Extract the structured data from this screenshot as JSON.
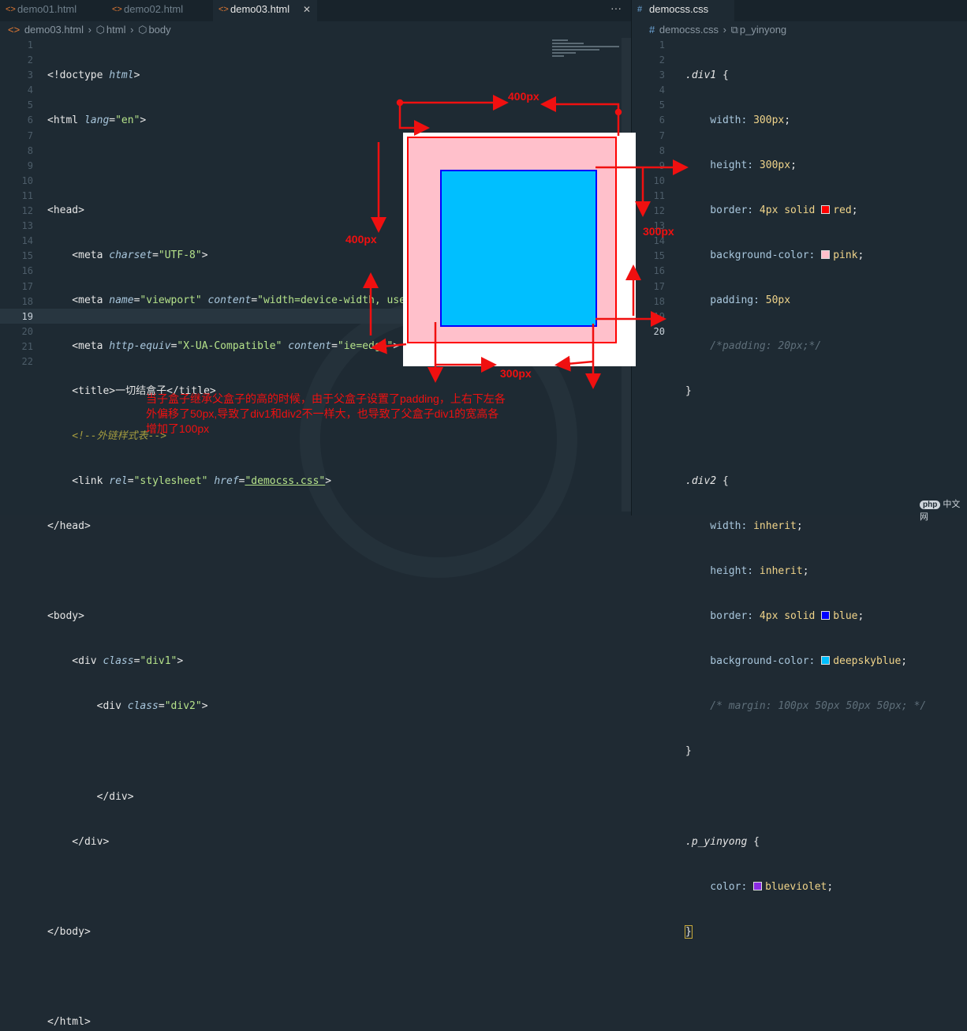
{
  "left_tabs": [
    {
      "label": "demo01.html",
      "active": false
    },
    {
      "label": "demo02.html",
      "active": false
    },
    {
      "label": "demo03.html",
      "active": true
    }
  ],
  "more_glyph": "···",
  "close_glyph": "✕",
  "left_crumb": [
    "demo03.html",
    "html",
    "body"
  ],
  "right_tab": "democss.css",
  "right_crumb": [
    "democss.css",
    "p_yinyong"
  ],
  "left_line_numbers": [
    "1",
    "2",
    "3",
    "4",
    "5",
    "6",
    "7",
    "8",
    "9",
    "10",
    "11",
    "12",
    "13",
    "14",
    "15",
    "16",
    "17",
    "18",
    "19",
    "20",
    "21",
    "22"
  ],
  "right_line_numbers": [
    "1",
    "2",
    "3",
    "4",
    "5",
    "6",
    "7",
    "8",
    "9",
    "10",
    "11",
    "12",
    "13",
    "14",
    "15",
    "16",
    "17",
    "18",
    "19",
    "20"
  ],
  "html_code": {
    "l1": {
      "a": "<!doctype ",
      "b": "html",
      "c": ">"
    },
    "l2": {
      "a": "<html ",
      "b": "lang",
      "c": "=",
      "d": "\"en\"",
      "e": ">"
    },
    "l4": "<head>",
    "l5": {
      "a": "    <meta ",
      "b": "charset",
      "c": "=",
      "d": "\"UTF-8\"",
      "e": ">"
    },
    "l6": {
      "a": "    <meta ",
      "b": "name",
      "c": "=",
      "d": "\"viewport\"",
      "e": " content",
      "f": "=",
      "g": "\"width=device-width, user-scalable=no, initial-sca"
    },
    "l7": {
      "a": "    <meta ",
      "b": "http-equiv",
      "c": "=",
      "d": "\"X-UA-Compatible\"",
      "e": " content",
      "f": "=",
      "g": "\"ie=edge\"",
      "h": ">"
    },
    "l8": {
      "a": "    <title>",
      "b": "一切结盒子",
      "c": "</title>"
    },
    "l9": "    <!--外链样式表-->",
    "l10": {
      "a": "    <link ",
      "b": "rel",
      "c": "=",
      "d": "\"stylesheet\"",
      "e": " href",
      "f": "=",
      "g": "\"democss.css\"",
      "h": ">"
    },
    "l11": "</head>",
    "l13": "<body>",
    "l14": {
      "a": "    <div ",
      "b": "class",
      "c": "=",
      "d": "\"div1\"",
      "e": ">"
    },
    "l15": {
      "a": "        <div ",
      "b": "class",
      "c": "=",
      "d": "\"div2\"",
      "e": ">"
    },
    "l17": "        </div>",
    "l18": "    </div>",
    "l20": "</body>",
    "l22": "</html>"
  },
  "css_code": {
    "r1": {
      "sel": ".div1",
      "brace": " {"
    },
    "r2": {
      "prop": "    width: ",
      "val": "300px",
      "end": ";"
    },
    "r3": {
      "prop": "    height: ",
      "val": "300px",
      "end": ";"
    },
    "r4": {
      "prop": "    border: ",
      "val": "4px solid ",
      "color": "red",
      "end": ";"
    },
    "r5": {
      "prop": "    background-color: ",
      "color": "pink",
      "end": ";"
    },
    "r6": {
      "prop": "    padding: ",
      "val": "50px"
    },
    "r7": "    /*padding: 20px;*/",
    "r8": "}",
    "r10": {
      "sel": ".div2",
      "brace": " {"
    },
    "r11": {
      "prop": "    width: ",
      "val": "inherit",
      "end": ";"
    },
    "r12": {
      "prop": "    height: ",
      "val": "inherit",
      "end": ";"
    },
    "r13": {
      "prop": "    border: ",
      "val": "4px solid ",
      "color": "blue",
      "end": ";"
    },
    "r14": {
      "prop": "    background-color: ",
      "color": "deepskyblue",
      "end": ";"
    },
    "r15": "    /* margin: 100px 50px 50px 50px; */",
    "r16": "}",
    "r18": {
      "sel": ".p_yinyong",
      "brace": " {"
    },
    "r19": {
      "prop": "    color: ",
      "color": "blueviolet",
      "end": ";"
    },
    "r20": "}"
  },
  "swatches": {
    "red": "#ff0000",
    "pink": "#ffc0cb",
    "blue": "#0000ff",
    "deepskyblue": "#00bfff",
    "blueviolet": "#8a2be2"
  },
  "annotations": {
    "top_400": "400px",
    "left_400": "400px",
    "right_300": "300px",
    "bottom_300": "300px",
    "note": "当子盒子继承父盒子的高的时候，由于父盒子设置了padding，上右下左各外偏移了50px,导致了div1和div2不一样大，也导致了父盒子div1的宽高各增加了100px"
  },
  "logo": {
    "badge": "php",
    "text": "中文网"
  },
  "colors": {
    "accent": "#e37933",
    "annotation": "#f01010"
  }
}
